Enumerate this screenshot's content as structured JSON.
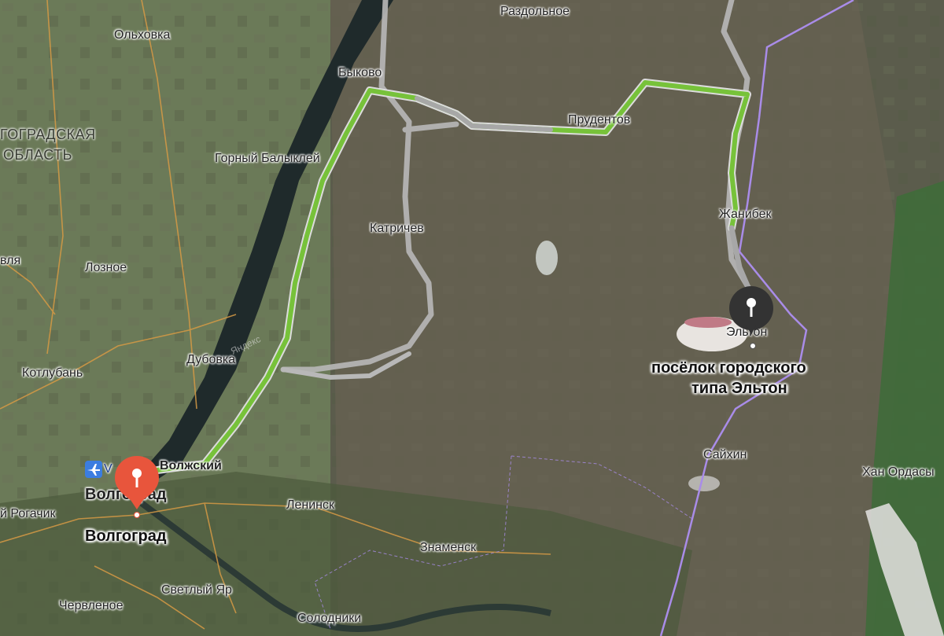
{
  "map": {
    "places": {
      "razdolnoe": "Раздольное",
      "olkhovka": "Ольховка",
      "bykovo": "Быково",
      "region_line1": "ГОГРАДСКАЯ",
      "region_line2": "ОБЛАСТЬ",
      "gorny_balykley": "Горный Балыклей",
      "prudentov": "Прудентов",
      "katrichev": "Катричев",
      "dzhanibek": "Жанибек",
      "vlya": "вля",
      "loznoe": "Лозное",
      "elton_small": "Эльтон",
      "dubovka": "Дубовка",
      "kotluban": "Котлубань",
      "saykhin": "Сайхин",
      "volzhsky": "Волжский",
      "khan_ordasy": "Хан Ордасы",
      "volgograd_city": "Волгоград",
      "rogachik": "й Рогачик",
      "leninsk": "Ленинск",
      "znamensk": "Знаменск",
      "svetly_yar": "Светлый Яр",
      "chervlenoe": "Червленое",
      "solodniki": "Солодники",
      "watermark": "Яндекс"
    },
    "airport_letter": "V",
    "route": {
      "start_label": "Волгоград",
      "end_label_line1": "посёлок городского",
      "end_label_line2": "типа Эльтон"
    },
    "colors": {
      "route_active": "#77c23a",
      "route_alt": "#b8b8b8",
      "start_pin": "#e8553c",
      "end_pin": "#333333",
      "border_purple": "#a98ce8",
      "roads": "#d69a45"
    }
  }
}
